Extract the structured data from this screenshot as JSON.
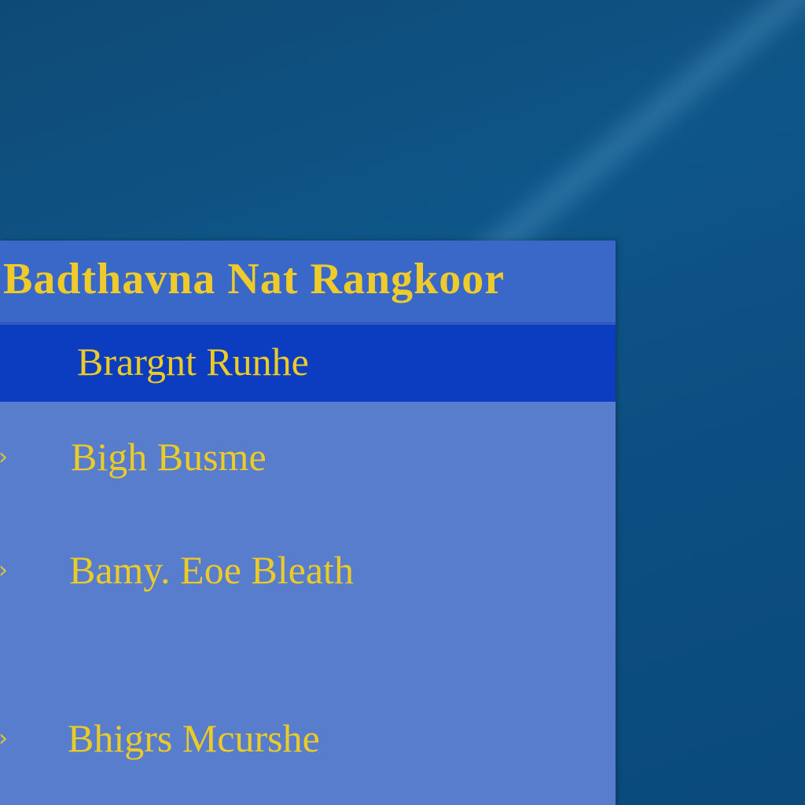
{
  "menu": {
    "title": "Badthavna Nat Rangkoor",
    "items": [
      {
        "label": "Brargnt Runhe",
        "selected": true,
        "arrow": ""
      },
      {
        "label": "Bigh Busme",
        "selected": false,
        "arrow": "›"
      },
      {
        "label": "Bamy. Eoe Bleath",
        "selected": false,
        "arrow": "›"
      },
      {
        "label": "Bhigrs Mcurshe",
        "selected": false,
        "arrow": "›"
      }
    ]
  },
  "colors": {
    "desktop_bg": "#0e5688",
    "panel_bg": "#577dcc",
    "header_bg": "#3a68c9",
    "selected_bg": "#0c3dc0",
    "text_yellow": "#eccb26"
  },
  "icons": {
    "item_arrow": "chevron-right-icon"
  }
}
